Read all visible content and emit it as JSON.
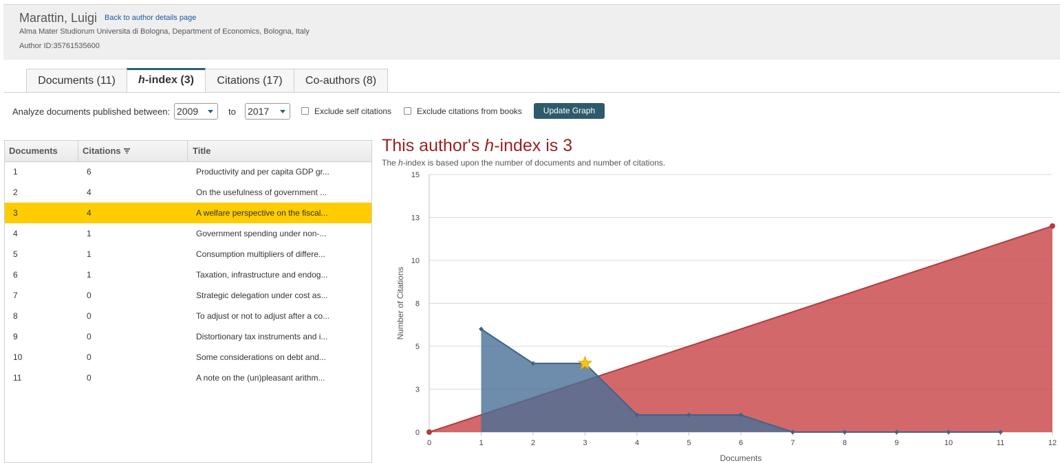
{
  "author": {
    "name": "Marattin, Luigi",
    "back_link": "Back to author details page",
    "affiliation": "Alma Mater Studiorum Universita di Bologna, Department of Economics, Bologna, Italy",
    "author_id": "Author ID:35761535600"
  },
  "tabs": [
    {
      "label": "Documents (11)",
      "active": false
    },
    {
      "label_prefix": "h",
      "label": "-index (3)",
      "active": true
    },
    {
      "label": "Citations (17)",
      "active": false
    },
    {
      "label": "Co-authors (8)",
      "active": false
    }
  ],
  "controls": {
    "analyze_label": "Analyze documents published between:",
    "from_year": "2009",
    "to_label": "to",
    "to_year": "2017",
    "exclude_self": "Exclude self citations",
    "exclude_books": "Exclude citations from books",
    "update_button": "Update Graph"
  },
  "table": {
    "headers": [
      "Documents",
      "Citations",
      "Title"
    ],
    "highlight_row": 3,
    "rows": [
      {
        "doc": "1",
        "cit": "6",
        "title": "Productivity and per capita GDP gr..."
      },
      {
        "doc": "2",
        "cit": "4",
        "title": "On the usefulness of government ..."
      },
      {
        "doc": "3",
        "cit": "4",
        "title": "A welfare perspective on the fiscal..."
      },
      {
        "doc": "4",
        "cit": "1",
        "title": "Government spending under non-..."
      },
      {
        "doc": "5",
        "cit": "1",
        "title": "Consumption multipliers of differe..."
      },
      {
        "doc": "6",
        "cit": "1",
        "title": "Taxation, infrastructure and endog..."
      },
      {
        "doc": "7",
        "cit": "0",
        "title": "Strategic delegation under cost as..."
      },
      {
        "doc": "8",
        "cit": "0",
        "title": "To adjust or not to adjust after a co..."
      },
      {
        "doc": "9",
        "cit": "0",
        "title": "Distortionary tax instruments and i..."
      },
      {
        "doc": "10",
        "cit": "0",
        "title": "Some considerations on debt and..."
      },
      {
        "doc": "11",
        "cit": "0",
        "title": "A note on the (un)pleasant arithm..."
      }
    ]
  },
  "hindex": {
    "title_pre": "This author's ",
    "title_it": "h",
    "title_post": "-index is 3",
    "sub_pre": "The ",
    "sub_it": "h",
    "sub_post": "-index is based upon the number of documents and number of citations."
  },
  "chart_data": {
    "type": "area",
    "xlabel": "Documents",
    "ylabel": "Number of Citations",
    "xlim": [
      0,
      12
    ],
    "ylim": [
      0,
      15
    ],
    "x_ticks": [
      0,
      1,
      2,
      3,
      4,
      5,
      6,
      7,
      8,
      9,
      10,
      11,
      12
    ],
    "y_tick_labels": [
      "0",
      "3",
      "5",
      "8",
      "10",
      "13",
      "15"
    ],
    "series": [
      {
        "color": "#c9474a",
        "x": [
          0,
          12
        ],
        "y": [
          0,
          12
        ]
      },
      {
        "color": "#4a6f96",
        "x": [
          1,
          2,
          3,
          4,
          5,
          6,
          7,
          8,
          9,
          10,
          11
        ],
        "y": [
          6,
          4,
          4,
          1,
          1,
          1,
          0,
          0,
          0,
          0,
          0
        ]
      }
    ],
    "marker": {
      "x": 3,
      "y": 4,
      "shape": "star-icon",
      "color": "#f7c21a"
    },
    "grid": true
  }
}
